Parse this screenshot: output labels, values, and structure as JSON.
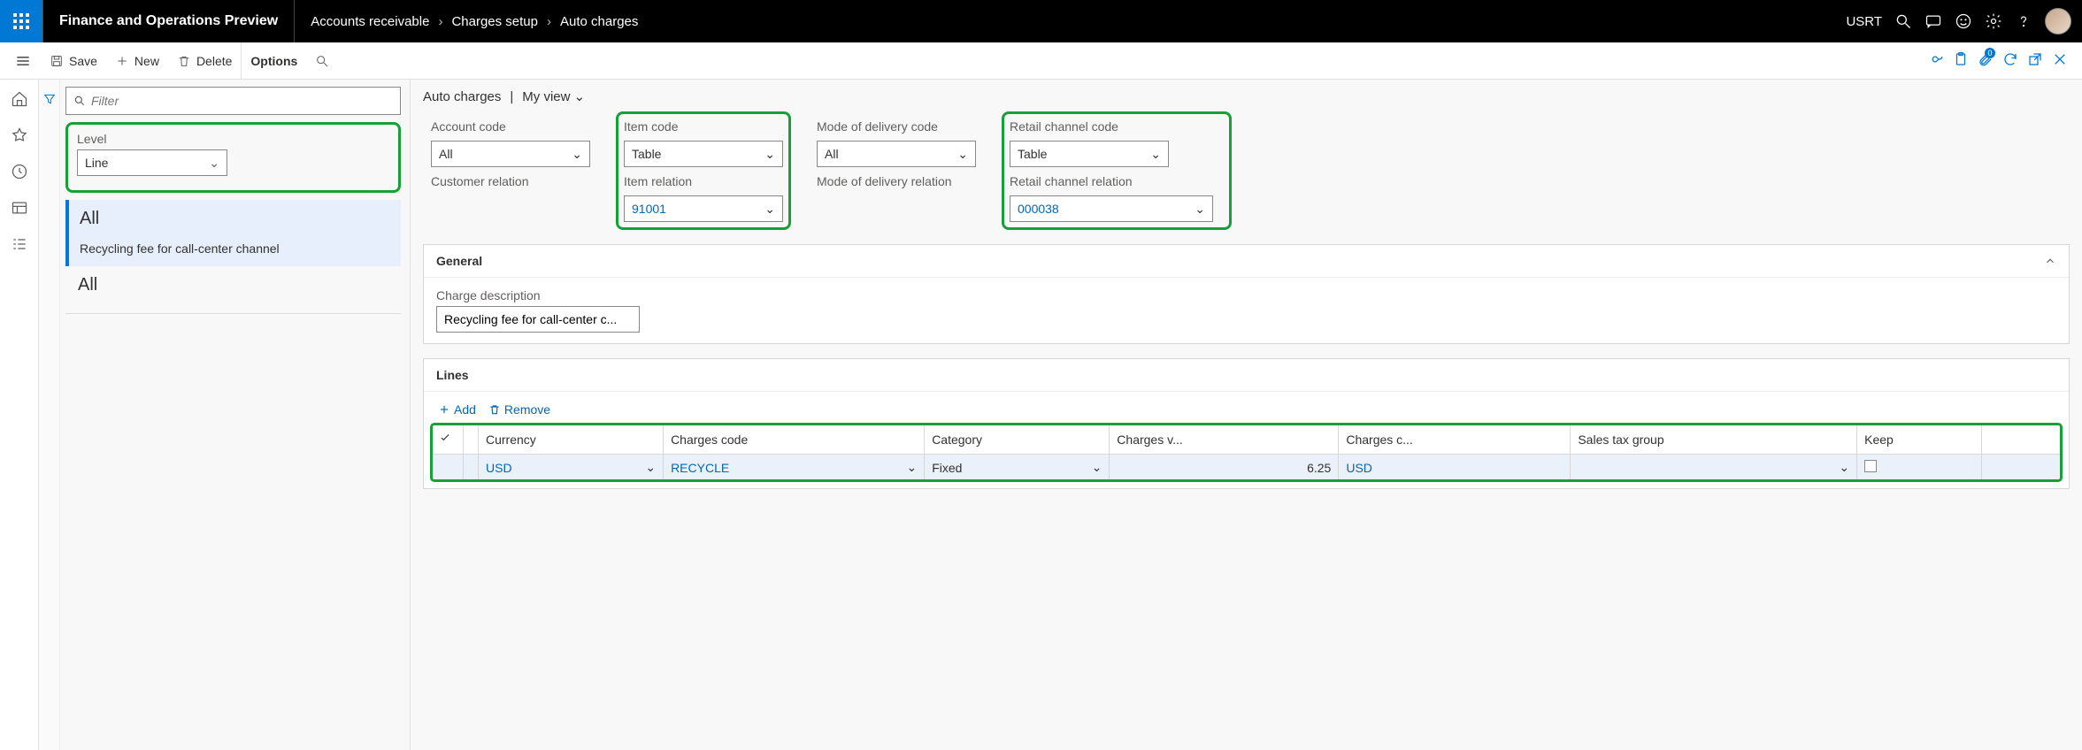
{
  "top": {
    "app_title": "Finance and Operations Preview",
    "crumbs": [
      "Accounts receivable",
      "Charges setup",
      "Auto charges"
    ],
    "entity": "USRT"
  },
  "actions": {
    "save": "Save",
    "new": "New",
    "delete": "Delete",
    "options": "Options",
    "badge_count": "0"
  },
  "left": {
    "filter_placeholder": "Filter",
    "level_label": "Level",
    "level_value": "Line",
    "list0_title": "All",
    "list0_sub": "Recycling fee for call-center channel",
    "list1_title": "All"
  },
  "main": {
    "page_title": "Auto charges",
    "view_label": "My view",
    "account_code_label": "Account code",
    "account_code_value": "All",
    "customer_relation_label": "Customer relation",
    "customer_relation_value": "",
    "item_code_label": "Item code",
    "item_code_value": "Table",
    "item_relation_label": "Item relation",
    "item_relation_value": "91001",
    "mode_code_label": "Mode of delivery code",
    "mode_code_value": "All",
    "mode_rel_label": "Mode of delivery relation",
    "mode_rel_value": "",
    "retail_code_label": "Retail channel code",
    "retail_code_value": "Table",
    "retail_rel_label": "Retail channel relation",
    "retail_rel_value": "000038"
  },
  "general": {
    "heading": "General",
    "charge_desc_label": "Charge description",
    "charge_desc_value": "Recycling fee for call-center c..."
  },
  "lines": {
    "heading": "Lines",
    "add": "Add",
    "remove": "Remove",
    "cols": {
      "currency": "Currency",
      "charges_code": "Charges code",
      "category": "Category",
      "charges_value": "Charges v...",
      "charges_currency": "Charges c...",
      "sales_tax": "Sales tax group",
      "keep": "Keep"
    },
    "row": {
      "currency": "USD",
      "charges_code": "RECYCLE",
      "category": "Fixed",
      "charges_value": "6.25",
      "charges_currency": "USD",
      "sales_tax": "",
      "keep": false
    }
  }
}
